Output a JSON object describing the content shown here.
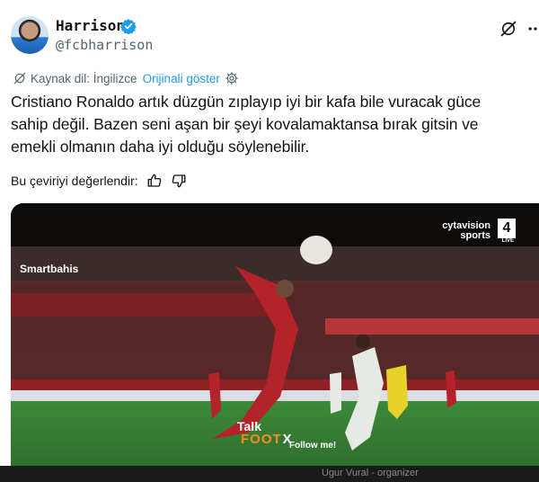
{
  "author": {
    "display_name": "Harrison",
    "handle": "@fcbharrison"
  },
  "translation": {
    "source_label": "Kaynak dil: İngilizce",
    "show_original": "Orijinali göster"
  },
  "tweet": {
    "line1": "Cristiano Ronaldo artık düzgün zıplayıp iyi bir kafa bile vuracak güce",
    "line2": "sahip değil. Bazen seni aşan bir şeyi kovalamaktansa bırak gitsin ve",
    "line3": "emekli olmanın daha iyi olduğu söylenebilir."
  },
  "rate_translation": "Bu çeviriyi değerlendir:",
  "video": {
    "broadcaster": "cytavision",
    "broadcaster_sub": "sports",
    "channel_number": "4",
    "live": "LIVE",
    "sponsor": "Smartbahis",
    "watermark_talk": "Talk",
    "watermark_foot": "FOOT",
    "watermark_x": "X",
    "follow": "Follow me!"
  },
  "footer_overlay": "Ugur Vural - organizer",
  "colors": {
    "accent": "#1d9bf0",
    "muted": "#536471",
    "text": "#0f1419"
  }
}
